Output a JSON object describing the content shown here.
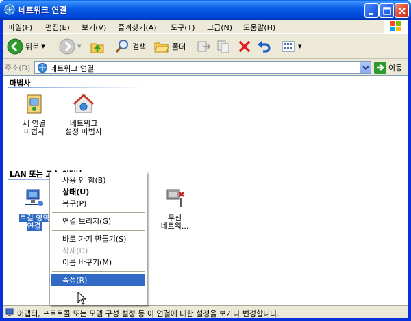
{
  "window": {
    "title": "네트워크 연결"
  },
  "menubar": {
    "items": [
      "파일(F)",
      "편집(E)",
      "보기(V)",
      "즐겨찾기(A)",
      "도구(T)",
      "고급(N)",
      "도움말(H)"
    ]
  },
  "toolbar": {
    "back_label": "뒤로",
    "search_label": "검색",
    "folders_label": "폴더"
  },
  "address": {
    "label": "주소(D)",
    "value": "네트워크 연결",
    "go_label": "이동"
  },
  "groups": [
    {
      "title": "마법사",
      "items": [
        {
          "caption": "새 연결\n마법사",
          "icon": "new-connection-wizard-icon"
        },
        {
          "caption": "네트워크\n설정 마법사",
          "icon": "network-setup-wizard-icon"
        }
      ]
    },
    {
      "title": "LAN 또는 고속 인터넷",
      "items": [
        {
          "caption": "로컬 영역\n연결",
          "icon": "lan-connection-icon",
          "selected": true
        },
        {
          "caption": "",
          "icon": "lan-connection-2-icon"
        },
        {
          "caption": "",
          "icon": "lan-connection-3-icon"
        },
        {
          "caption": "무선\n네트워...",
          "icon": "wireless-connection-disabled-icon"
        }
      ]
    }
  ],
  "context_menu": {
    "items": [
      {
        "label": "사용 안 함(B)"
      },
      {
        "label": "상태(U)",
        "bold": true
      },
      {
        "label": "복구(P)"
      },
      {
        "separator": true
      },
      {
        "label": "연결 브리지(G)"
      },
      {
        "separator": true
      },
      {
        "label": "바로 가기 만들기(S)"
      },
      {
        "label": "삭제(D)",
        "disabled": true
      },
      {
        "label": "이름 바꾸기(M)"
      },
      {
        "separator": true
      },
      {
        "label": "속성(R)",
        "highlighted": true
      }
    ]
  },
  "statusbar": {
    "text": "어댑터, 프로토콜 또는 모뎀 구성 설정 등 이 연결에 대한 설정을 보거나 변경합니다."
  },
  "colors": {
    "titlebar": "#0a5fe8",
    "selection": "#316ac5",
    "chrome": "#ece9d8"
  }
}
